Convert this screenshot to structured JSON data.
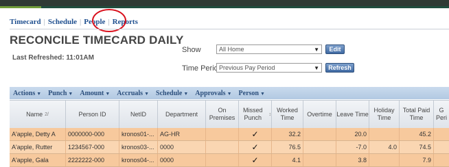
{
  "nav": {
    "tabs": [
      "Timecard",
      "Schedule",
      "People",
      "Reports"
    ]
  },
  "page": {
    "title": "RECONCILE TIMECARD DAILY",
    "last_refreshed": "Last Refreshed: 11:01AM"
  },
  "controls": {
    "show_label": "Show",
    "show_value": "All Home",
    "time_period_label": "Time Period",
    "time_period_value": "Previous Pay Period",
    "edit_label": "Edit",
    "refresh_label": "Refresh"
  },
  "actions": [
    "Actions",
    "Punch",
    "Amount",
    "Accruals",
    "Schedule",
    "Approvals",
    "Person"
  ],
  "table": {
    "columns": [
      "Name",
      "Person ID",
      "NetID",
      "Department",
      "On Premises",
      "Missed Punch",
      "Worked Time",
      "Overtime",
      "Leave Time",
      "Holiday Time",
      "Total Paid Time",
      "G Peri"
    ],
    "rows": [
      {
        "name": "A'apple, Detty A",
        "person_id": "0000000-000",
        "netid": "kronos01-...",
        "department": "AG-HR",
        "on_premises": "",
        "missed_punch": "✓",
        "worked": "32.2",
        "overtime": "",
        "leave": "20.0",
        "holiday": "",
        "total": "45.2",
        "period": ""
      },
      {
        "name": "A'apple, Rutter",
        "person_id": "1234567-000",
        "netid": "kronos03-...",
        "department": "0000",
        "on_premises": "",
        "missed_punch": "✓",
        "worked": "76.5",
        "overtime": "",
        "leave": "-7.0",
        "holiday": "4.0",
        "total": "74.5",
        "period": ""
      },
      {
        "name": "A'apple, Gala",
        "person_id": "2222222-000",
        "netid": "kronos04-...",
        "department": "0000",
        "on_premises": "",
        "missed_punch": "✓",
        "worked": "4.1",
        "overtime": "",
        "leave": "3.8",
        "holiday": "",
        "total": "7.9",
        "period": ""
      }
    ]
  },
  "colors": {
    "nav_text": "#1f4f8f",
    "highlight_circle": "#d90f1c",
    "row_bg": "#f7c99d",
    "actions_bar": "#b2c9e2"
  }
}
